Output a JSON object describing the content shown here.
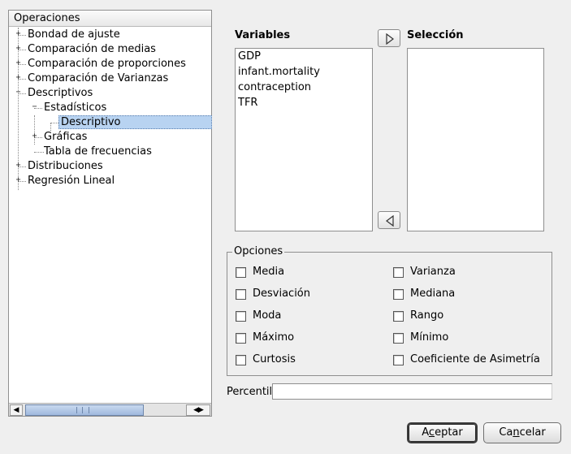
{
  "tree": {
    "header": "Operaciones",
    "nodes": [
      {
        "label": "Bondad de ajuste",
        "expander": "+"
      },
      {
        "label": "Comparación de medias",
        "expander": "+"
      },
      {
        "label": "Comparación de proporciones",
        "expander": "+"
      },
      {
        "label": "Comparación de Varianzas",
        "expander": "+"
      },
      {
        "label": "Descriptivos",
        "expander": "−"
      },
      {
        "label": "Estadísticos",
        "expander": "−"
      },
      {
        "label": "Descriptivo",
        "expander": ""
      },
      {
        "label": "Gráficas",
        "expander": "+"
      },
      {
        "label": "Tabla de frecuencias",
        "expander": ""
      },
      {
        "label": "Distribuciones",
        "expander": "+"
      },
      {
        "label": "Regresión Lineal",
        "expander": "+"
      }
    ],
    "selected": "Descriptivo"
  },
  "variables": {
    "title": "Variables",
    "items": [
      "GDP",
      "infant.mortality",
      "contraception",
      "TFR"
    ]
  },
  "selection": {
    "title": "Selección",
    "items": []
  },
  "options": {
    "legend": "Opciones",
    "left": [
      {
        "label": "Media",
        "checked": false
      },
      {
        "label": "Desviación",
        "checked": false
      },
      {
        "label": "Moda",
        "checked": false
      },
      {
        "label": "Máximo",
        "checked": false
      },
      {
        "label": "Curtosis",
        "checked": false
      }
    ],
    "right": [
      {
        "label": "Varianza",
        "checked": false
      },
      {
        "label": "Mediana",
        "checked": false
      },
      {
        "label": "Rango",
        "checked": false
      },
      {
        "label": "Mínimo",
        "checked": false
      },
      {
        "label": "Coeficiente de Asimetría",
        "checked": false
      }
    ]
  },
  "percentil": {
    "label": "Percentil",
    "value": ""
  },
  "buttons": {
    "accept": {
      "pre": "A",
      "mnemonic": "c",
      "post": "eptar"
    },
    "cancel": {
      "pre": "Ca",
      "mnemonic": "n",
      "post": "celar"
    }
  },
  "colors": {
    "selection_bg": "#b8d3f1",
    "window_bg": "#efefef"
  },
  "icons": {
    "add": "triangle-right-icon",
    "remove": "triangle-left-icon"
  }
}
